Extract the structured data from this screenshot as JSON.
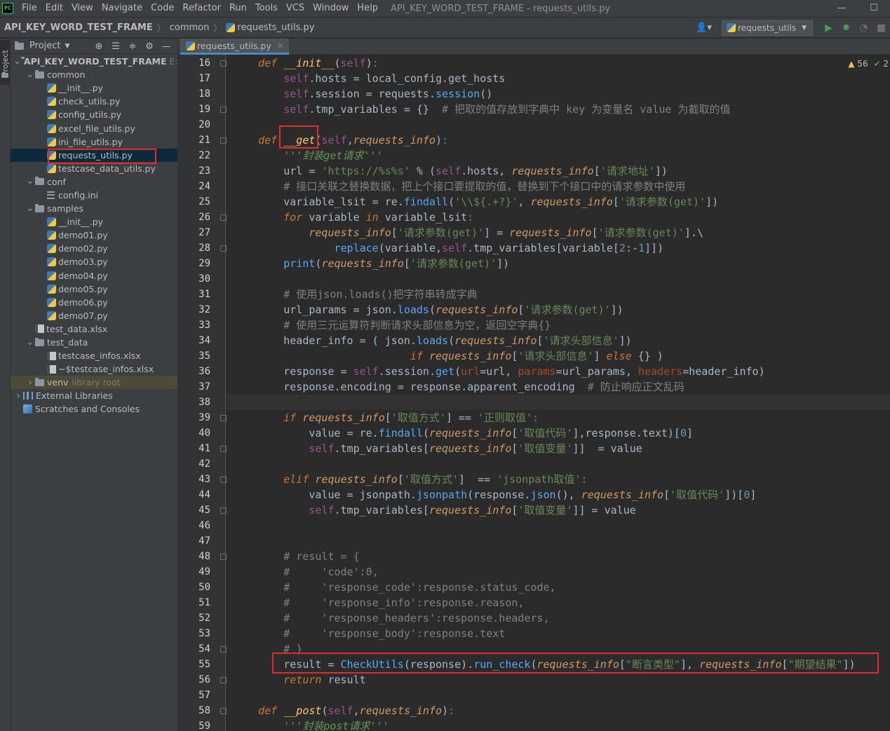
{
  "app": {
    "logo_text": "PC",
    "menu": [
      "File",
      "Edit",
      "View",
      "Navigate",
      "Code",
      "Refactor",
      "Run",
      "Tools",
      "VCS",
      "Window",
      "Help"
    ],
    "window_title": "API_KEY_WORD_TEST_FRAME - requests_utils.py",
    "minimize": "—",
    "maximize": "☐"
  },
  "navbar": {
    "crumbs": [
      "API_KEY_WORD_TEST_FRAME",
      "common",
      "requests_utils.py"
    ],
    "run_config": "requests_utils"
  },
  "side_strip": {
    "tab_label": "Project"
  },
  "project_panel": {
    "title": "Project",
    "tree": [
      {
        "depth": 0,
        "type": "root",
        "label": "API_KEY_WORD_TEST_FRAME",
        "path": "E:\\p",
        "expanded": true
      },
      {
        "depth": 1,
        "type": "folder",
        "label": "common",
        "expanded": true
      },
      {
        "depth": 2,
        "type": "py",
        "label": "__init__.py"
      },
      {
        "depth": 2,
        "type": "py",
        "label": "check_utils.py"
      },
      {
        "depth": 2,
        "type": "py",
        "label": "config_utils.py"
      },
      {
        "depth": 2,
        "type": "py",
        "label": "excel_file_utils.py"
      },
      {
        "depth": 2,
        "type": "py",
        "label": "ini_file_utils.py"
      },
      {
        "depth": 2,
        "type": "py",
        "label": "requests_utils.py",
        "selected": true
      },
      {
        "depth": 2,
        "type": "py",
        "label": "testcase_data_utils.py"
      },
      {
        "depth": 1,
        "type": "folder",
        "label": "conf",
        "expanded": true
      },
      {
        "depth": 2,
        "type": "ini",
        "label": "config.ini"
      },
      {
        "depth": 1,
        "type": "folder",
        "label": "samples",
        "expanded": true
      },
      {
        "depth": 2,
        "type": "py",
        "label": "__init__.py"
      },
      {
        "depth": 2,
        "type": "py",
        "label": "demo01.py"
      },
      {
        "depth": 2,
        "type": "py",
        "label": "demo02.py"
      },
      {
        "depth": 2,
        "type": "py",
        "label": "demo03.py"
      },
      {
        "depth": 2,
        "type": "py",
        "label": "demo04.py"
      },
      {
        "depth": 2,
        "type": "py",
        "label": "demo05.py"
      },
      {
        "depth": 2,
        "type": "py",
        "label": "demo06.py"
      },
      {
        "depth": 2,
        "type": "py",
        "label": "demo07.py"
      },
      {
        "depth": 1,
        "type": "xlsx",
        "label": "test_data.xlsx"
      },
      {
        "depth": 1,
        "type": "folder",
        "label": "test_data",
        "expanded": true
      },
      {
        "depth": 2,
        "type": "xlsx",
        "label": "testcase_infos.xlsx"
      },
      {
        "depth": 2,
        "type": "xlsx",
        "label": "~$testcase_infos.xlsx"
      },
      {
        "depth": 1,
        "type": "folder",
        "label": "venv",
        "hint": "library root",
        "expanded": false,
        "venv": true
      },
      {
        "depth": 0,
        "type": "lib",
        "label": "External Libraries",
        "expanded": false
      },
      {
        "depth": 0,
        "type": "scratch",
        "label": "Scratches and Consoles"
      }
    ]
  },
  "editor": {
    "tab_label": "requests_utils.py",
    "inspections": {
      "warnings": "56",
      "ok_count": "2"
    },
    "current_line": 38,
    "lines": [
      {
        "n": 16,
        "fold": true,
        "html": "    <span class=\"kw\">def</span> <span class=\"fn\">__init__</span>(<span class=\"slf\">self</span>)<span class=\"cmt\">:</span>"
      },
      {
        "n": 17,
        "html": "        <span class=\"slf\">self</span>.hosts = local_config.get_hosts"
      },
      {
        "n": 18,
        "html": "        <span class=\"slf\">self</span>.session = requests.<span class=\"mth\">session</span>()"
      },
      {
        "n": 19,
        "fold": true,
        "html": "        <span class=\"slf\">self</span>.tmp_variables = {}  <span class=\"cmt\"># 把取的值存放到字典中 key 为变量名 value 为截取的值</span>"
      },
      {
        "n": 20,
        "html": ""
      },
      {
        "n": 21,
        "fold": true,
        "html": "    <span class=\"kw\">def</span> <span class=\"fn\">__get</span>(<span class=\"slf\">self</span>,<span class=\"prm\">requests_info</span>)<span class=\"cmt\">:</span>"
      },
      {
        "n": 22,
        "html": "        <span class=\"doc\">'''封装get请求'''</span>"
      },
      {
        "n": 23,
        "html": "        url = <span class=\"str\">'https://%s%s'</span> % (<span class=\"slf\">self</span>.hosts, <span class=\"prm\">requests_info</span>[<span class=\"str\">'请求地址'</span>])"
      },
      {
        "n": 24,
        "html": "        <span class=\"cmt\"># 接口关联之替换数据，把上个接口要提取的值，替换到下个接口中的请求参数中使用</span>"
      },
      {
        "n": 25,
        "html": "        variable_lsit = re.<span class=\"mth\">findall</span>(<span class=\"str\">'\\\\${.+?}'</span>, <span class=\"prm\">requests_info</span>[<span class=\"str\">'请求参数(get)'</span>])"
      },
      {
        "n": 26,
        "fold": true,
        "html": "        <span class=\"kw\">for</span> variable <span class=\"kw\">in</span> variable_lsit<span class=\"cmt\">:</span>"
      },
      {
        "n": 27,
        "html": "            <span class=\"prm\">requests_info</span>[<span class=\"str\">'请求参数(get)'</span>] = <span class=\"prm\">requests_info</span>[<span class=\"str\">'请求参数(get)'</span>].\\"
      },
      {
        "n": 28,
        "fold": true,
        "html": "                <span class=\"mth\">replace</span>(variable,<span class=\"slf\">self</span>.tmp_variables[variable[<span class=\"num\">2</span>:-<span class=\"num\">1</span>]])"
      },
      {
        "n": 29,
        "html": "        <span class=\"mth\">print</span>(<span class=\"prm\">requests_info</span>[<span class=\"str\">'请求参数(get)'</span>])"
      },
      {
        "n": 30,
        "html": ""
      },
      {
        "n": 31,
        "html": "        <span class=\"cmt\"># 使用json.loads()把字符串转成字典</span>"
      },
      {
        "n": 32,
        "html": "        url_params = json.<span class=\"mth\">loads</span>(<span class=\"prm\">requests_info</span>[<span class=\"str\">'请求参数(get)'</span>])"
      },
      {
        "n": 33,
        "html": "        <span class=\"cmt\"># 使用三元运算符判断请求头部信息为空，返回空字典{}</span>"
      },
      {
        "n": 34,
        "html": "        header_info = ( json.<span class=\"mth\">loads</span>(<span class=\"prm\">requests_info</span>[<span class=\"str\">'请求头部信息'</span>])"
      },
      {
        "n": 35,
        "html": "                            <span class=\"kw\">if</span> <span class=\"prm\">requests_info</span>[<span class=\"str\">'请求头部信息'</span>] <span class=\"kw\">else</span> {} )"
      },
      {
        "n": 36,
        "html": "        response = <span class=\"slf\">self</span>.session.<span class=\"mth\">get</span>(<span class=\"kwarg\">url</span>=url, <span class=\"kwarg\">params</span>=url_params, <span class=\"kwarg\">headers</span>=header_info)"
      },
      {
        "n": 37,
        "html": "        response.encoding = response.apparent_encoding  <span class=\"cmt\"># 防止响应正文乱码</span>"
      },
      {
        "n": 38,
        "html": ""
      },
      {
        "n": 39,
        "fold": true,
        "html": "        <span class=\"kw\">if</span> <span class=\"prm\">requests_info</span>[<span class=\"str\">'取值方式'</span>] == <span class=\"str\">'正则取值'</span><span class=\"cmt\">:</span>"
      },
      {
        "n": 40,
        "html": "            value = re.<span class=\"mth\">findall</span>(<span class=\"prm\">requests_info</span>[<span class=\"str\">'取值代码'</span>],response.text)[<span class=\"num\">0</span>]"
      },
      {
        "n": 41,
        "fold": true,
        "html": "            <span class=\"slf\">self</span>.tmp_variables[<span class=\"prm\">requests_info</span>[<span class=\"str\">'取值变量'</span>]]  = value"
      },
      {
        "n": 42,
        "html": ""
      },
      {
        "n": 43,
        "fold": true,
        "html": "        <span class=\"kw\">elif</span> <span class=\"prm\">requests_info</span>[<span class=\"str\">'取值方式'</span>]  == <span class=\"str\">'jsonpath取值'</span><span class=\"cmt\">:</span>"
      },
      {
        "n": 44,
        "html": "            value = jsonpath.<span class=\"mth\">jsonpath</span>(response.<span class=\"mth\">json</span>(), <span class=\"prm\">requests_info</span>[<span class=\"str\">'取值代码'</span>])[<span class=\"num\">0</span>]"
      },
      {
        "n": 45,
        "fold": true,
        "html": "            <span class=\"slf\">self</span>.tmp_variables[<span class=\"prm\">requests_info</span>[<span class=\"str\">'取值变量'</span>]] = value"
      },
      {
        "n": 46,
        "html": ""
      },
      {
        "n": 47,
        "html": ""
      },
      {
        "n": 48,
        "fold": true,
        "html": "        <span class=\"cmt\"># result = {</span>"
      },
      {
        "n": 49,
        "html": "        <span class=\"cmt\">#     'code':0,</span>"
      },
      {
        "n": 50,
        "html": "        <span class=\"cmt\">#     'response_code':response.status_code,</span>"
      },
      {
        "n": 51,
        "html": "        <span class=\"cmt\">#     'response_info':response.reason,</span>"
      },
      {
        "n": 52,
        "html": "        <span class=\"cmt\">#     'response_headers':response.headers,</span>"
      },
      {
        "n": 53,
        "html": "        <span class=\"cmt\">#     'response_body':response.text</span>"
      },
      {
        "n": 54,
        "fold": true,
        "html": "        <span class=\"cmt\"># }</span>"
      },
      {
        "n": 55,
        "html": "        result = <span class=\"mth\">CheckUtils</span>(response).<span class=\"mth\">run_check</span>(<span class=\"prm\">requests_info</span>[<span class=\"str\">\"断言类型\"</span>], <span class=\"prm\">requests_info</span>[<span class=\"str\">\"期望结果\"</span>])"
      },
      {
        "n": 56,
        "fold": true,
        "html": "        <span class=\"kw\">return</span> result"
      },
      {
        "n": 57,
        "html": ""
      },
      {
        "n": 58,
        "fold": true,
        "html": "    <span class=\"kw\">def</span> <span class=\"fn\">__post</span>(<span class=\"slf\">self</span>,<span class=\"prm\">requests_info</span>)<span class=\"cmt\">:</span>"
      },
      {
        "n": 59,
        "html": "        <span class=\"doc\">'''封装post请求'''</span>"
      }
    ]
  }
}
